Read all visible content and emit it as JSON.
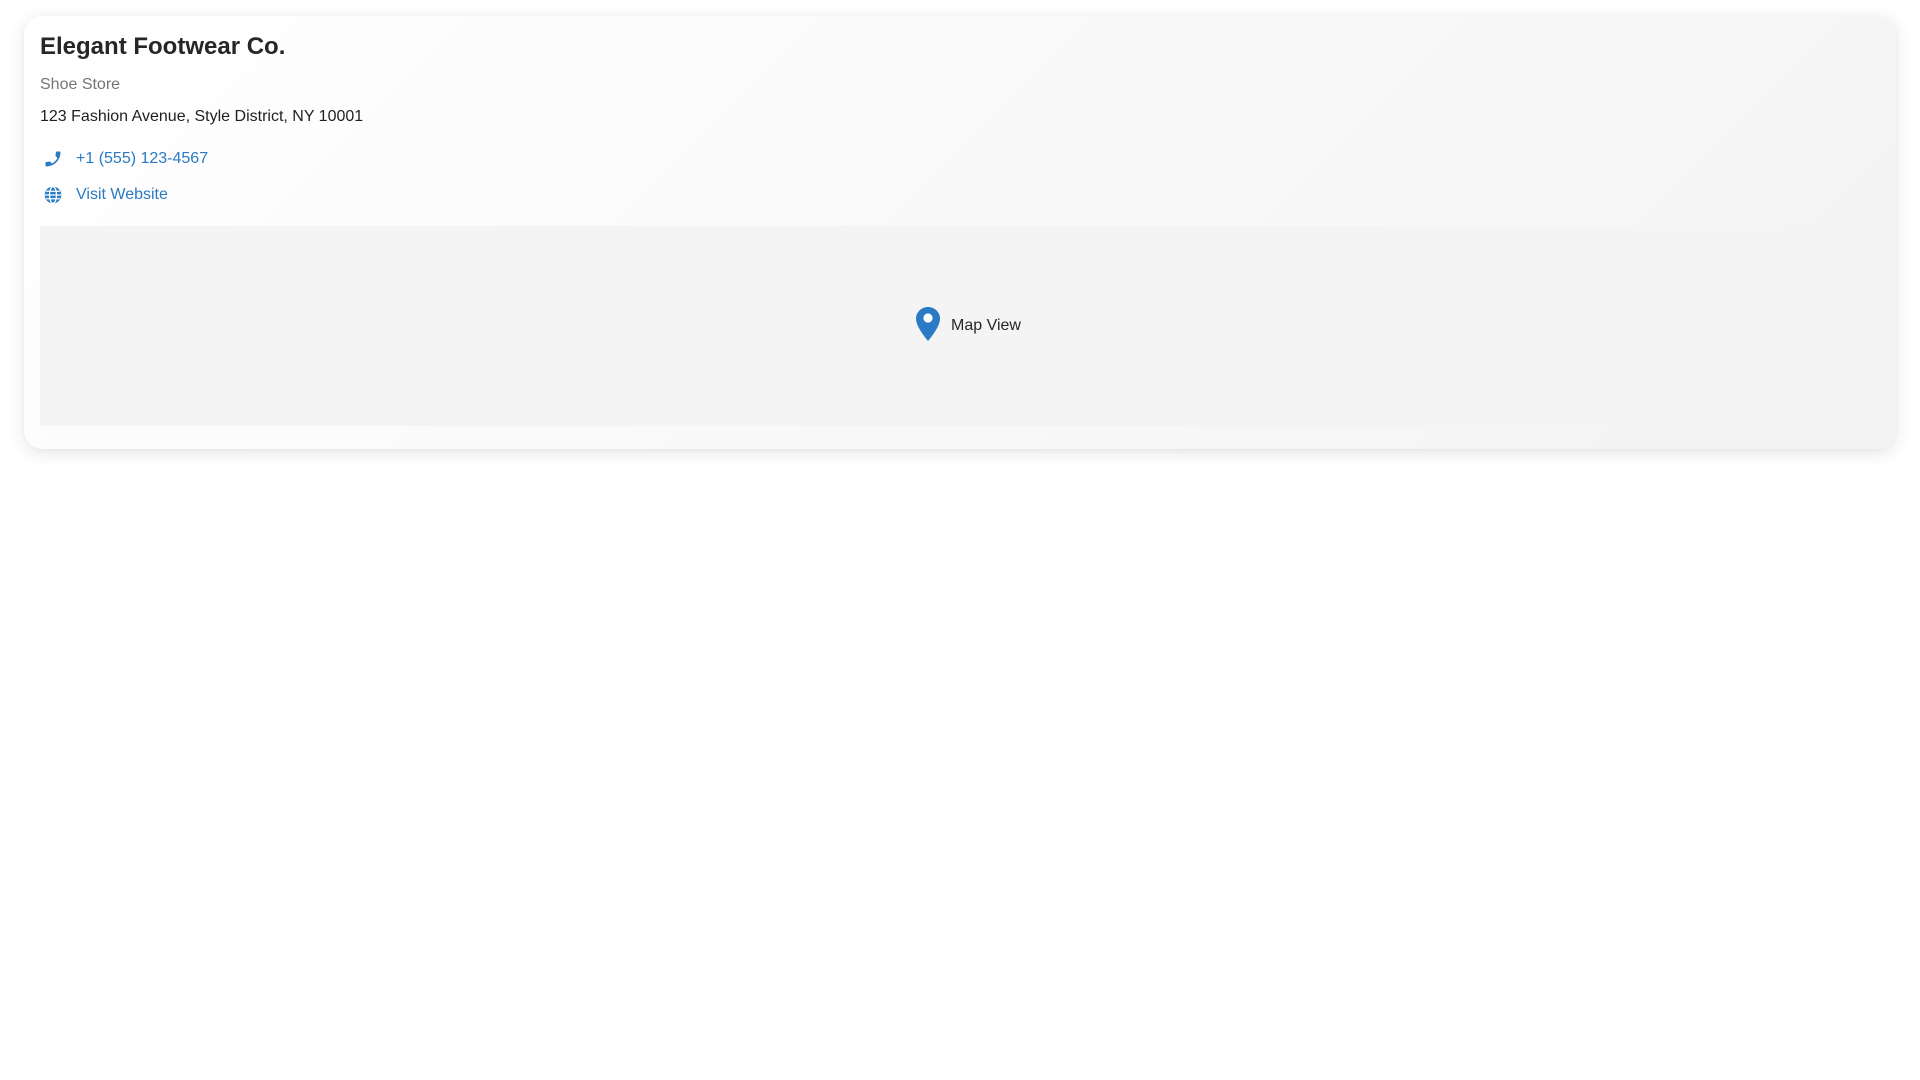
{
  "business": {
    "name": "Elegant Footwear Co.",
    "category": "Shoe Store",
    "address": "123 Fashion Avenue, Style District, NY 10001"
  },
  "contact": {
    "phone": {
      "icon": "phone-icon",
      "label": "+1 (555) 123-4567"
    },
    "website": {
      "icon": "globe-icon",
      "label": "Visit Website"
    }
  },
  "map": {
    "icon": "map-pin-icon",
    "label": "Map View"
  },
  "colors": {
    "accent": "#2a7ac4",
    "title": "#262626",
    "muted": "#757575",
    "map_background": "#f4f4f4"
  }
}
